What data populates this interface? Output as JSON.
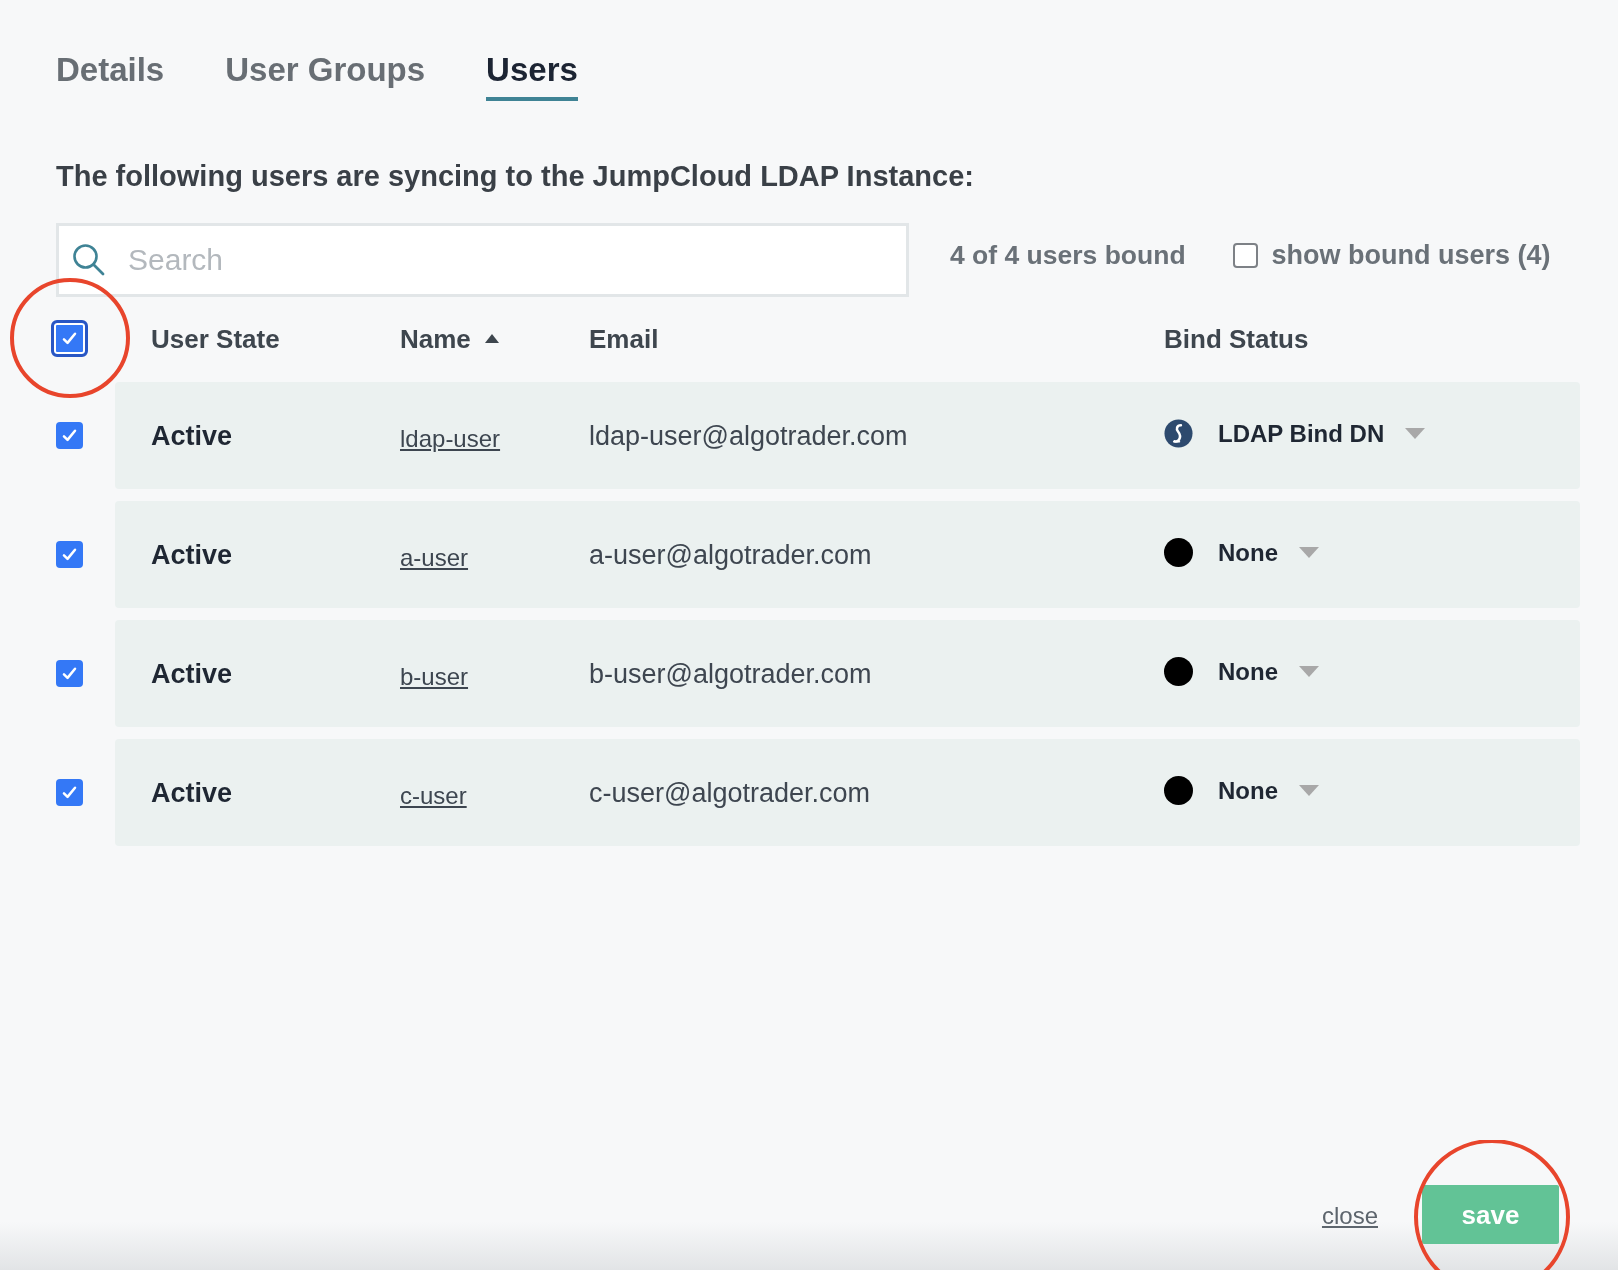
{
  "tabs": [
    {
      "label": "Details",
      "selected": false
    },
    {
      "label": "User Groups",
      "selected": false
    },
    {
      "label": "Users",
      "selected": true
    }
  ],
  "heading": "The following users are syncing to the JumpCloud LDAP Instance:",
  "search": {
    "placeholder": "Search"
  },
  "bound_count": "4 of 4 users bound",
  "show_bound": {
    "label": "show bound users (4)",
    "checked": false
  },
  "table": {
    "select_all": {
      "checked": true,
      "highlighted": true
    },
    "columns": [
      {
        "label": "User State",
        "sorted": false
      },
      {
        "label": "Name",
        "sorted": true
      },
      {
        "label": "Email",
        "sorted": false
      },
      {
        "label": "Bind Status",
        "sorted": false
      }
    ],
    "rows": [
      {
        "checked": true,
        "state": "Active",
        "name": "ldap-user",
        "email": "ldap-user@algotrader.com",
        "bind_status": {
          "kind": "ldap",
          "label": "LDAP Bind DN"
        }
      },
      {
        "checked": true,
        "state": "Active",
        "name": "a-user",
        "email": "a-user@algotrader.com",
        "bind_status": {
          "kind": "none",
          "label": "None"
        }
      },
      {
        "checked": true,
        "state": "Active",
        "name": "b-user",
        "email": "b-user@algotrader.com",
        "bind_status": {
          "kind": "none",
          "label": "None"
        }
      },
      {
        "checked": true,
        "state": "Active",
        "name": "c-user",
        "email": "c-user@algotrader.com",
        "bind_status": {
          "kind": "none",
          "label": "None"
        }
      }
    ]
  },
  "footer": {
    "close": "close",
    "save": {
      "label": "save",
      "highlighted": true
    }
  }
}
